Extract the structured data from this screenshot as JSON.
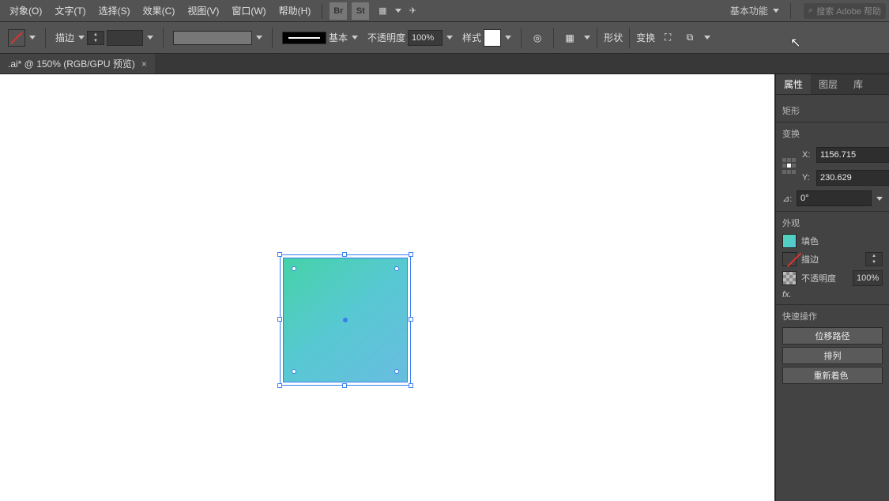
{
  "menu": {
    "items": [
      "对象(O)",
      "文字(T)",
      "选择(S)",
      "效果(C)",
      "视图(V)",
      "窗口(W)",
      "帮助(H)"
    ],
    "workspace_label": "基本功能",
    "search_placeholder": "搜索 Adobe 帮助"
  },
  "options": {
    "stroke_label": "描边",
    "stroke_pt": "",
    "profile_label": "基本",
    "opacity_label": "不透明度",
    "opacity_value": "100%",
    "style_label": "样式",
    "shape_label": "形状",
    "transform_label": "变换"
  },
  "doc": {
    "title": ".ai* @ 150% (RGB/GPU 预览)"
  },
  "panel": {
    "tabs": [
      "属性",
      "图层",
      "库"
    ],
    "object_type": "矩形",
    "transform_header": "变换",
    "x_label": "X:",
    "y_label": "Y:",
    "x_value": "1156.715",
    "y_value": "230.629",
    "angle_symbol": "⊿:",
    "angle_value": "0°",
    "appearance_header": "外观",
    "fill_label": "填色",
    "stroke_label": "描边",
    "opacity_label": "不透明度",
    "opacity_value": "100%",
    "fx_label": "fx.",
    "quick_header": "快速操作",
    "btn_offset": "位移路径",
    "btn_arrange": "排列",
    "btn_recolor": "重新着色"
  }
}
